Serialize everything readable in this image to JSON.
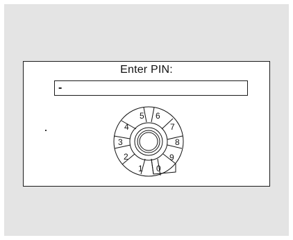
{
  "dialog": {
    "title": "Enter PIN:",
    "pin_value": "-"
  },
  "dial": {
    "digits": [
      "0",
      "1",
      "2",
      "3",
      "4",
      "5",
      "6",
      "7",
      "8",
      "9"
    ]
  }
}
